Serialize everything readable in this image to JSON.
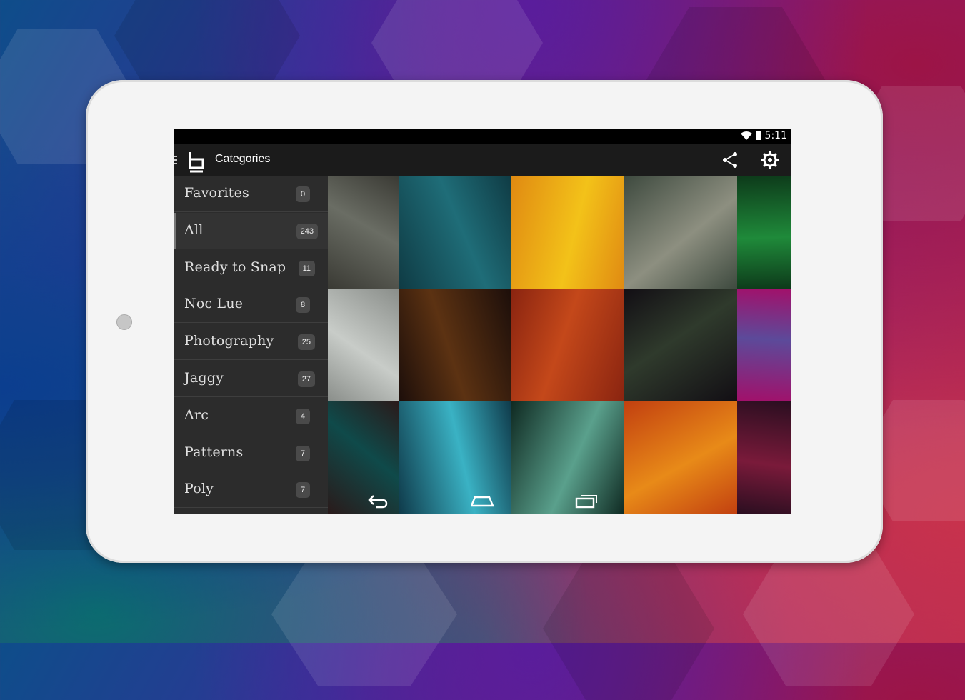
{
  "status_bar": {
    "time": "5:11",
    "wifi_icon": "wifi-icon",
    "battery_icon": "battery-icon"
  },
  "action_bar": {
    "title": "Categories",
    "logo_icon": "app-logo-b-icon",
    "share_icon": "share-icon",
    "settings_icon": "gear-icon"
  },
  "categories": [
    {
      "label": "Favorites",
      "count": "0"
    },
    {
      "label": "All",
      "count": "243",
      "selected": true
    },
    {
      "label": "Ready to Snap",
      "count": "11"
    },
    {
      "label": "Noc Lue",
      "count": "8"
    },
    {
      "label": "Photography",
      "count": "25"
    },
    {
      "label": "Jaggy",
      "count": "27"
    },
    {
      "label": "Arc",
      "count": "4"
    },
    {
      "label": "Patterns",
      "count": "7"
    },
    {
      "label": "Poly",
      "count": "7"
    }
  ],
  "nav_bar": {
    "back_icon": "back-icon",
    "home_icon": "home-icon",
    "recents_icon": "recents-icon"
  },
  "wallpapers": [
    {
      "colors": [
        "#3a3a34",
        "#6a6d64"
      ]
    },
    {
      "colors": [
        "#0f3b44",
        "#1f6d78"
      ]
    },
    {
      "colors": [
        "#e08a12",
        "#f3c219"
      ]
    },
    {
      "colors": [
        "#3e4a3f",
        "#8d8f80"
      ]
    },
    {
      "colors": [
        "#0d3a1a",
        "#1f8a3a"
      ]
    },
    {
      "colors": [
        "#8a8e8a",
        "#c8ccc8"
      ]
    },
    {
      "colors": [
        "#1c0e0a",
        "#5c3212"
      ]
    },
    {
      "colors": [
        "#8a2410",
        "#c4481a"
      ]
    },
    {
      "colors": [
        "#120e14",
        "#2f3a2c"
      ]
    },
    {
      "colors": [
        "#a2106a",
        "#5c4a9a"
      ]
    },
    {
      "colors": [
        "#2a1a1a",
        "#0f4a4a"
      ]
    },
    {
      "colors": [
        "#0f3a4a",
        "#3ab2c4"
      ]
    },
    {
      "colors": [
        "#0f2a22",
        "#5aa08c"
      ]
    },
    {
      "colors": [
        "#c24010",
        "#e88a18"
      ]
    },
    {
      "colors": [
        "#2a0e20",
        "#7a1a3a"
      ]
    }
  ]
}
